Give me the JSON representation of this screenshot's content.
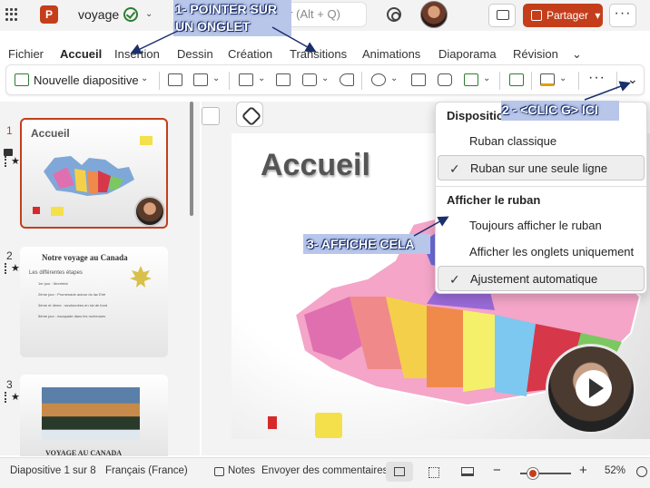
{
  "titlebar": {
    "app": "PowerPoint",
    "app_letter": "P",
    "document_title": "voyage",
    "search_placeholder": "er (Alt + Q)",
    "share_label": "Partager",
    "share_chevron": "▾",
    "more_label": "···",
    "accent_color": "#c43e1c"
  },
  "tabs": [
    {
      "label": "Fichier",
      "active": false
    },
    {
      "label": "Accueil",
      "active": true
    },
    {
      "label": "Insertion",
      "active": false
    },
    {
      "label": "Dessin",
      "active": false
    },
    {
      "label": "Création",
      "active": false
    },
    {
      "label": "Transitions",
      "active": false
    },
    {
      "label": "Animations",
      "active": false
    },
    {
      "label": "Diaporama",
      "active": false
    },
    {
      "label": "Révision",
      "active": false
    }
  ],
  "tabs_overflow": "⌄",
  "ribbon": {
    "new_slide_label": "Nouvelle diapositive",
    "more_label": "···",
    "expand_chevron": "⌄"
  },
  "thumbnails": [
    {
      "number": "1",
      "title": "Accueil"
    },
    {
      "number": "2",
      "title": "Notre voyage au Canada",
      "subtitle": "Les différentes étapes",
      "bullets": [
        "1er jour : Montréal",
        "2ème jour : Promenade autour du lac Erié",
        "3ème et 4ème : randonnées en ski de fond",
        "5ème jour : escapade dans les rocheuses"
      ]
    },
    {
      "number": "3",
      "title": "VOYAGE AU CANADA"
    }
  ],
  "slide": {
    "title": "Accueil"
  },
  "dropdown": {
    "layout_heading": "Disposition",
    "items_layout": [
      {
        "label": "Ruban classique",
        "checked": false
      },
      {
        "label": "Ruban sur une seule ligne",
        "checked": true
      }
    ],
    "show_heading": "Afficher le ruban",
    "items_show": [
      {
        "label": "Toujours afficher le ruban",
        "checked": false
      },
      {
        "label": "Afficher les onglets uniquement",
        "checked": false
      },
      {
        "label": "Ajustement automatique",
        "checked": true
      }
    ],
    "check_glyph": "✓"
  },
  "annotations": {
    "step1_line1": "1- POINTER SUR",
    "step1_line2": "UN ONGLET",
    "step2": "2 - <CLIC G> ICI",
    "step3": "3- AFFICHE CELA"
  },
  "statusbar": {
    "slide_count": "Diapositive 1 sur 8",
    "language": "Français (France)",
    "notes_label": "Notes",
    "feedback_label": "Envoyer des commentaires à",
    "zoom_minus": "−",
    "zoom_plus": "+",
    "zoom_level": "52%",
    "zoom_fraction": 0.52
  }
}
